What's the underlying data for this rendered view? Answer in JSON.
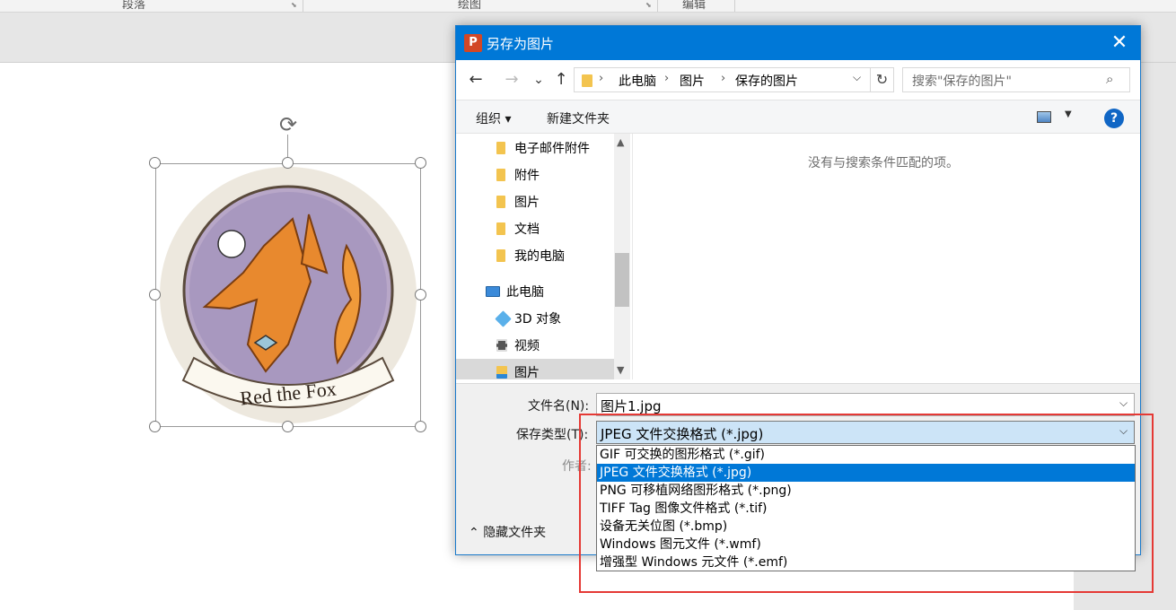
{
  "app": {
    "ribbon_groups": [
      "段落",
      "绘图",
      "编辑"
    ]
  },
  "slide_image": {
    "caption": "Red the Fox"
  },
  "dialog": {
    "title": "另存为图片",
    "app_icon_letter": "P",
    "close_glyph": "✕",
    "nav": {
      "back": "←",
      "forward": "→",
      "recent": "⌄",
      "up": "↑",
      "breadcrumb": [
        "此电脑",
        "图片",
        "保存的图片"
      ],
      "refresh": "↻",
      "search_placeholder": "搜索\"保存的图片\""
    },
    "commands": {
      "organize": "组织 ▾",
      "new_folder": "新建文件夹",
      "help": "?"
    },
    "tree": [
      {
        "label": "电子邮件附件",
        "type": "folder"
      },
      {
        "label": "附件",
        "type": "folder"
      },
      {
        "label": "图片",
        "type": "folder"
      },
      {
        "label": "文档",
        "type": "folder"
      },
      {
        "label": "我的电脑",
        "type": "folder"
      },
      {
        "label": "此电脑",
        "type": "pc"
      },
      {
        "label": "3D 对象",
        "type": "cube"
      },
      {
        "label": "视频",
        "type": "film"
      },
      {
        "label": "图片",
        "type": "pictures",
        "selected": true
      }
    ],
    "empty_message": "没有与搜索条件匹配的项。",
    "form": {
      "filename_label": "文件名(N):",
      "filename_value": "图片1.jpg",
      "filetype_label": "保存类型(T):",
      "filetype_value": "JPEG 文件交换格式 (*.jpg)",
      "author_label": "作者:",
      "hide_folders": "隐藏文件夹"
    },
    "filetype_options": [
      "GIF 可交换的图形格式 (*.gif)",
      "JPEG 文件交换格式 (*.jpg)",
      "PNG 可移植网络图形格式 (*.png)",
      "TIFF Tag 图像文件格式 (*.tif)",
      "设备无关位图 (*.bmp)",
      "Windows 图元文件 (*.wmf)",
      "增强型 Windows 元文件 (*.emf)"
    ],
    "selected_option_index": 1
  },
  "colors": {
    "titlebar": "#0078d7",
    "annotation": "#e53935",
    "selection": "#0078d7"
  }
}
